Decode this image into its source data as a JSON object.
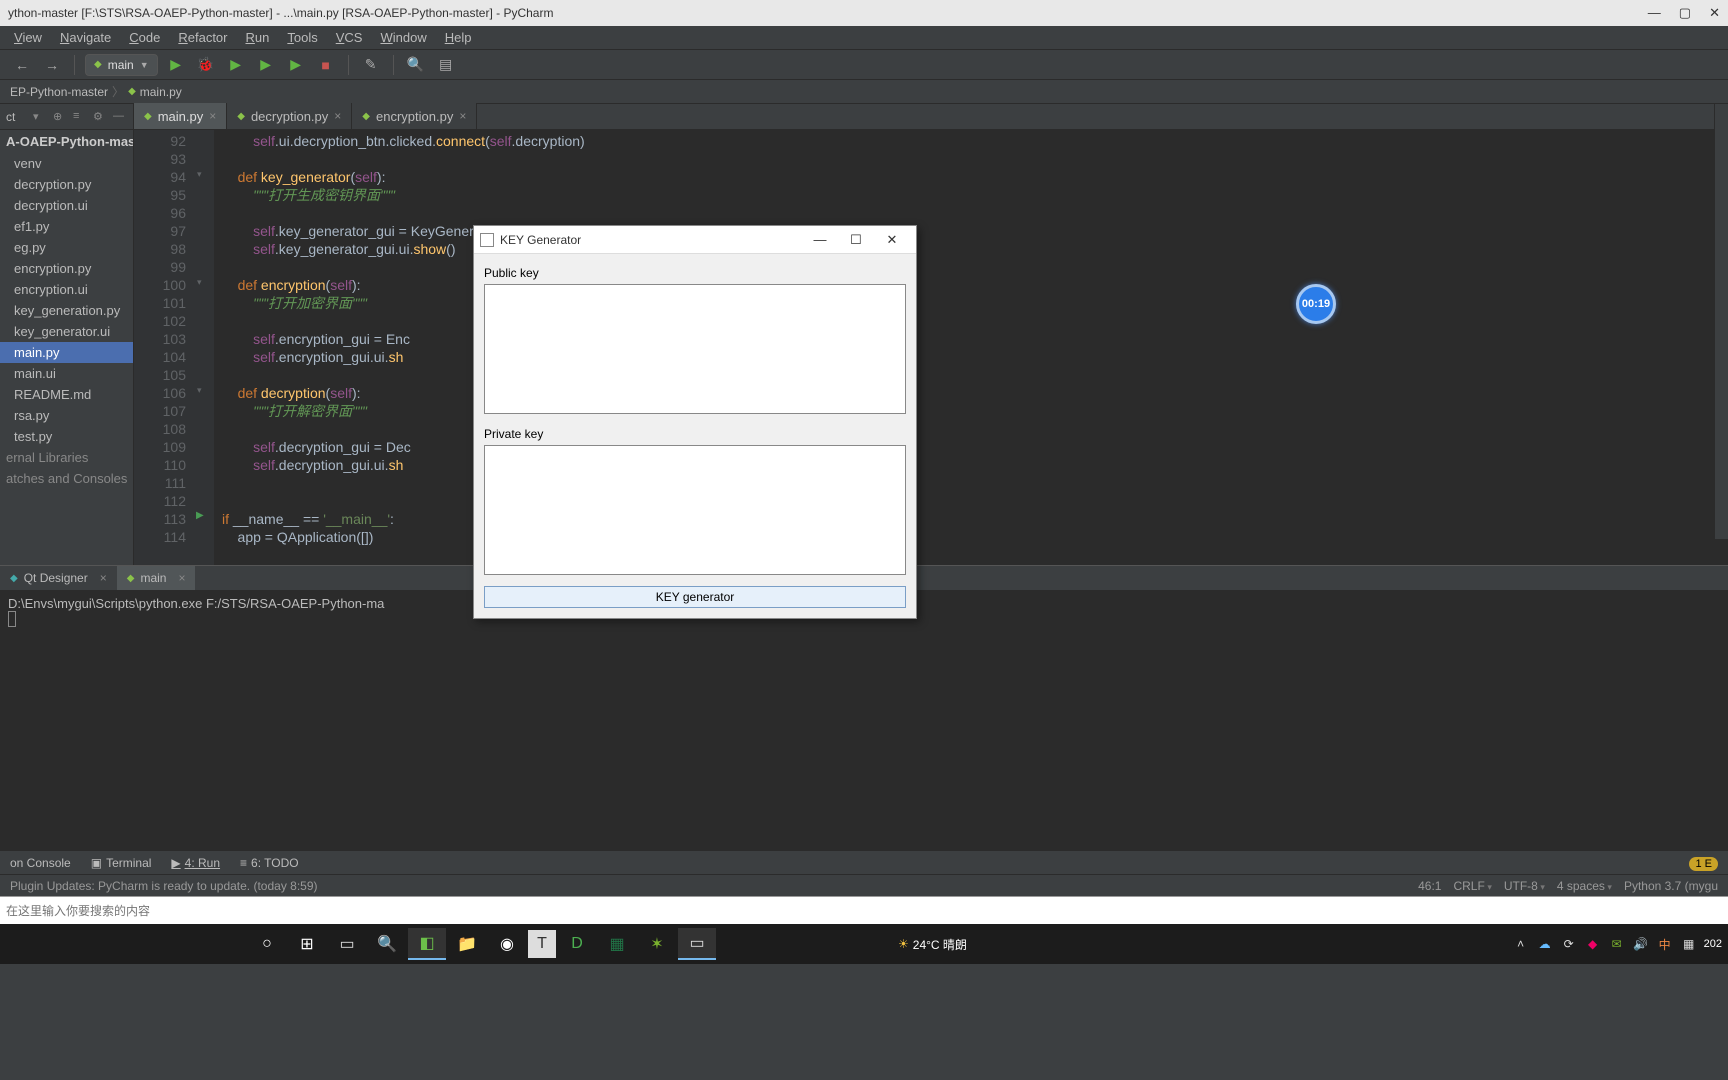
{
  "window_title": "ython-master [F:\\STS\\RSA-OAEP-Python-master] - ...\\main.py [RSA-OAEP-Python-master] - PyCharm",
  "menus": [
    "View",
    "Navigate",
    "Code",
    "Refactor",
    "Run",
    "Tools",
    "VCS",
    "Window",
    "Help"
  ],
  "run_config": "main",
  "breadcrumb1": "EP-Python-master",
  "breadcrumb2": "main.py",
  "project_header": "ct",
  "tree_root": "A-OAEP-Python-master",
  "tree": [
    "venv",
    "decryption.py",
    "decryption.ui",
    "ef1.py",
    "eg.py",
    "encryption.py",
    "encryption.ui",
    "key_generation.py",
    "key_generator.ui",
    "main.py",
    "main.ui",
    "README.md",
    "rsa.py",
    "test.py"
  ],
  "tree_extra": [
    "ernal Libraries",
    "atches and Consoles"
  ],
  "editor_tabs": [
    {
      "name": "main.py",
      "active": true
    },
    {
      "name": "decryption.py",
      "active": false
    },
    {
      "name": "encryption.py",
      "active": false
    }
  ],
  "gutter_lines": [
    "92",
    "93",
    "94",
    "95",
    "96",
    "97",
    "98",
    "99",
    "100",
    "101",
    "102",
    "103",
    "104",
    "105",
    "106",
    "107",
    "108",
    "109",
    "110",
    "111",
    "112",
    "113",
    "114"
  ],
  "code_lines": [
    {
      "indent": 8,
      "frag": [
        [
          "self",
          "self"
        ],
        [
          "",
          ".ui.decryption_btn.clicked."
        ],
        [
          "fn",
          "connect"
        ],
        [
          "",
          "("
        ],
        [
          "self",
          "self"
        ],
        [
          "",
          ".decryption)"
        ]
      ]
    },
    {
      "indent": 0,
      "frag": []
    },
    {
      "indent": 4,
      "frag": [
        [
          "kw",
          "def "
        ],
        [
          "fn",
          "key_generator"
        ],
        [
          "",
          "("
        ],
        [
          "self",
          "self"
        ],
        [
          "",
          "):"
        ]
      ]
    },
    {
      "indent": 8,
      "frag": [
        [
          "doc",
          "\"\"\"打开生成密钥界面\"\"\""
        ]
      ]
    },
    {
      "indent": 0,
      "frag": []
    },
    {
      "indent": 8,
      "frag": [
        [
          "self",
          "self"
        ],
        [
          "",
          ".key_generator_gui = "
        ],
        [
          "cls",
          "KeyGeneratorGui"
        ],
        [
          "",
          "()"
        ]
      ]
    },
    {
      "indent": 8,
      "frag": [
        [
          "self",
          "self"
        ],
        [
          "",
          ".key_generator_gui.ui."
        ],
        [
          "fn",
          "show"
        ],
        [
          "",
          "()"
        ]
      ]
    },
    {
      "indent": 0,
      "frag": []
    },
    {
      "indent": 4,
      "frag": [
        [
          "kw",
          "def "
        ],
        [
          "fn",
          "encryption"
        ],
        [
          "",
          "("
        ],
        [
          "self",
          "self"
        ],
        [
          "",
          "):"
        ]
      ]
    },
    {
      "indent": 8,
      "frag": [
        [
          "doc",
          "\"\"\"打开加密界面\"\"\""
        ]
      ]
    },
    {
      "indent": 0,
      "frag": []
    },
    {
      "indent": 8,
      "frag": [
        [
          "self",
          "self"
        ],
        [
          "",
          ".encryption_gui = "
        ],
        [
          "cls",
          "Enc"
        ]
      ]
    },
    {
      "indent": 8,
      "frag": [
        [
          "self",
          "self"
        ],
        [
          "",
          ".encryption_gui.ui."
        ],
        [
          "fn",
          "sh"
        ]
      ]
    },
    {
      "indent": 0,
      "frag": []
    },
    {
      "indent": 4,
      "frag": [
        [
          "kw",
          "def "
        ],
        [
          "fn",
          "decryption"
        ],
        [
          "",
          "("
        ],
        [
          "self",
          "self"
        ],
        [
          "",
          "):"
        ]
      ]
    },
    {
      "indent": 8,
      "frag": [
        [
          "doc",
          "\"\"\"打开解密界面\"\"\""
        ]
      ]
    },
    {
      "indent": 0,
      "frag": []
    },
    {
      "indent": 8,
      "frag": [
        [
          "self",
          "self"
        ],
        [
          "",
          ".decryption_gui = "
        ],
        [
          "cls",
          "Dec"
        ]
      ]
    },
    {
      "indent": 8,
      "frag": [
        [
          "self",
          "self"
        ],
        [
          "",
          ".decryption_gui.ui."
        ],
        [
          "fn",
          "sh"
        ]
      ]
    },
    {
      "indent": 0,
      "frag": []
    },
    {
      "indent": 0,
      "frag": []
    },
    {
      "indent": 0,
      "frag": [
        [
          "kw",
          "if "
        ],
        [
          "",
          "__name__ == "
        ],
        [
          "str",
          "'__main__'"
        ],
        [
          "",
          ":"
        ]
      ],
      "play": true
    },
    {
      "indent": 4,
      "frag": [
        [
          "",
          "app = "
        ],
        [
          "cls",
          "QApplication"
        ],
        [
          "",
          "([])"
        ]
      ]
    }
  ],
  "run_tabs": [
    "Qt Designer",
    "main"
  ],
  "console_line": "D:\\Envs\\mygui\\Scripts\\python.exe  F:/STS/RSA-OAEP-Python-ma",
  "bottom_tools": [
    {
      "lbl": "on Console"
    },
    {
      "lbl": "Terminal",
      "ic": "▣"
    },
    {
      "lbl": "4: Run",
      "ic": "▶",
      "u": true
    },
    {
      "lbl": "6: TODO",
      "ic": "≡"
    }
  ],
  "status_msg": "Plugin Updates: PyCharm is ready to update. (today 8:59)",
  "status_right": [
    "46:1",
    "CRLF",
    "UTF-8",
    "4 spaces",
    "Python 3.7 (mygu"
  ],
  "event_badge": "1 E",
  "search_placeholder": "在这里输入你要搜索的内容",
  "weather": "24°C 晴朗",
  "dialog": {
    "title": "KEY Generator",
    "public_lbl": "Public key",
    "private_lbl": "Private key",
    "button": "KEY generator"
  },
  "timer": "00:19",
  "time": "202"
}
